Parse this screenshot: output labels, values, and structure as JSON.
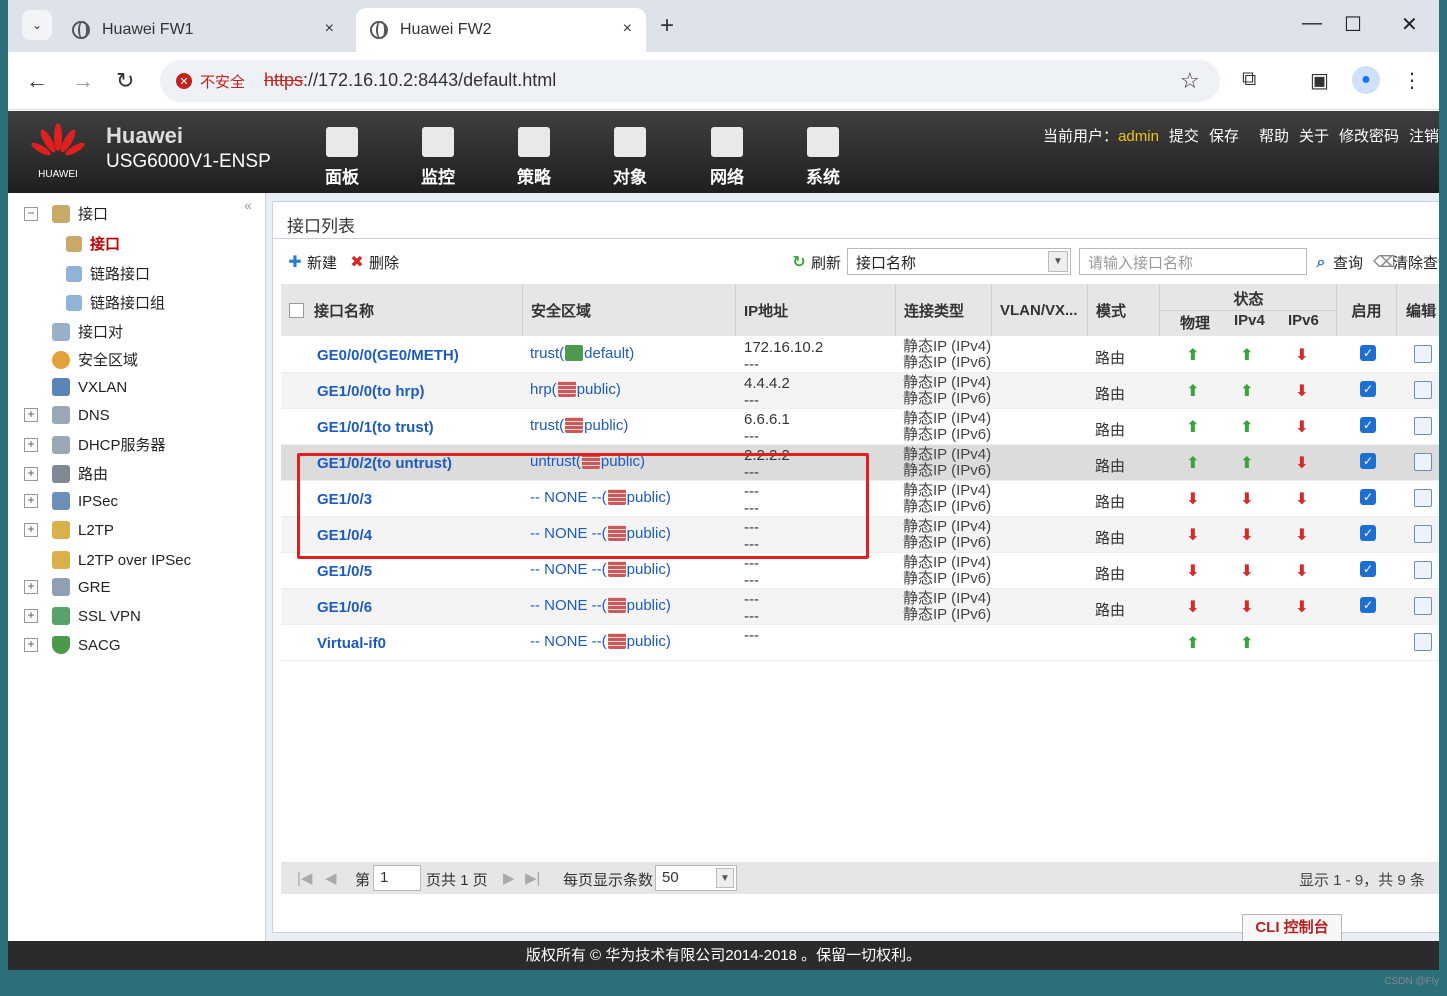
{
  "browser": {
    "tabs": [
      {
        "title": "Huawei FW1",
        "close": "×"
      },
      {
        "title": "Huawei FW2",
        "close": "×"
      }
    ],
    "new_tab": "+",
    "insecure_label": "不安全",
    "url_scheme": "https",
    "url_rest": "://172.16.10.2:8443/default.html"
  },
  "app": {
    "brand_name": "Huawei",
    "brand_model": "USG6000V1-ENSP",
    "logo_text": "HUAWEI",
    "menus": [
      {
        "label": "面板",
        "icon": "dashboard-icon"
      },
      {
        "label": "监控",
        "icon": "monitor-icon"
      },
      {
        "label": "策略",
        "icon": "policy-icon"
      },
      {
        "label": "对象",
        "icon": "object-icon"
      },
      {
        "label": "网络",
        "icon": "network-icon"
      },
      {
        "label": "系统",
        "icon": "system-icon"
      }
    ],
    "active_menu": "网络",
    "userbar": {
      "current_user_label": "当前用户：",
      "username": "admin",
      "links": [
        "提交",
        "保存",
        "帮助",
        "关于",
        "修改密码",
        "注销"
      ]
    }
  },
  "nav": {
    "items": [
      {
        "label": "接口",
        "expander": "−"
      },
      {
        "label": "接口"
      },
      {
        "label": "链路接口"
      },
      {
        "label": "链路接口组"
      },
      {
        "label": "接口对"
      },
      {
        "label": "安全区域"
      },
      {
        "label": "VXLAN"
      },
      {
        "label": "DNS",
        "expander": "+"
      },
      {
        "label": "DHCP服务器",
        "expander": "+"
      },
      {
        "label": "路由",
        "expander": "+"
      },
      {
        "label": "IPSec",
        "expander": "+"
      },
      {
        "label": "L2TP",
        "expander": "+"
      },
      {
        "label": "L2TP over IPSec"
      },
      {
        "label": "GRE",
        "expander": "+"
      },
      {
        "label": "SSL VPN",
        "expander": "+"
      },
      {
        "label": "SACG",
        "expander": "+"
      }
    ],
    "collapse": "«"
  },
  "panel": {
    "title": "接口列表",
    "toolbar": {
      "new": "新建",
      "delete": "删除",
      "refresh": "刷新",
      "filter_select": "接口名称",
      "search_placeholder": "请输入接口名称",
      "query": "查询",
      "clear": "清除查询"
    },
    "headers": {
      "name": "接口名称",
      "zone": "安全区域",
      "ip": "IP地址",
      "conn": "连接类型",
      "vlan": "VLAN/VX...",
      "mode": "模式",
      "status": "状态",
      "phys": "物理",
      "ipv4": "IPv4",
      "ipv6": "IPv6",
      "enable": "启用",
      "edit": "编辑"
    },
    "rows": [
      {
        "name": "GE0/0/0(GE0/METH)",
        "zone_a": "trust(",
        "zone_b": "default)",
        "ip1": "172.16.10.2",
        "ip2": "---",
        "conn1": "静态IP (IPv4)",
        "conn2": "静态IP (IPv6)",
        "mode": "路由",
        "phys": "up",
        "ipv4": "up",
        "ipv6": "down",
        "enabled": true
      },
      {
        "name": "GE1/0/0(to hrp)",
        "zone_a": "hrp(",
        "zone_b": "public)",
        "ip1": "4.4.4.2",
        "ip2": "---",
        "conn1": "静态IP (IPv4)",
        "conn2": "静态IP (IPv6)",
        "mode": "路由",
        "phys": "up",
        "ipv4": "up",
        "ipv6": "down",
        "enabled": true
      },
      {
        "name": "GE1/0/1(to trust)",
        "zone_a": "trust(",
        "zone_b": "public)",
        "ip1": "6.6.6.1",
        "ip2": "---",
        "conn1": "静态IP (IPv4)",
        "conn2": "静态IP (IPv6)",
        "mode": "路由",
        "phys": "up",
        "ipv4": "up",
        "ipv6": "down",
        "enabled": true
      },
      {
        "name": "GE1/0/2(to untrust)",
        "zone_a": "untrust(",
        "zone_b": "public)",
        "ip1": "2.2.2.2",
        "ip2": "---",
        "conn1": "静态IP (IPv4)",
        "conn2": "静态IP (IPv6)",
        "mode": "路由",
        "phys": "up",
        "ipv4": "up",
        "ipv6": "down",
        "enabled": true
      },
      {
        "name": "GE1/0/3",
        "zone_a": "-- NONE --(",
        "zone_b": "public)",
        "ip1": "---",
        "ip2": "---",
        "conn1": "静态IP (IPv4)",
        "conn2": "静态IP (IPv6)",
        "mode": "路由",
        "phys": "down",
        "ipv4": "down",
        "ipv6": "down",
        "enabled": true
      },
      {
        "name": "GE1/0/4",
        "zone_a": "-- NONE --(",
        "zone_b": "public)",
        "ip1": "---",
        "ip2": "---",
        "conn1": "静态IP (IPv4)",
        "conn2": "静态IP (IPv6)",
        "mode": "路由",
        "phys": "down",
        "ipv4": "down",
        "ipv6": "down",
        "enabled": true
      },
      {
        "name": "GE1/0/5",
        "zone_a": "-- NONE --(",
        "zone_b": "public)",
        "ip1": "---",
        "ip2": "---",
        "conn1": "静态IP (IPv4)",
        "conn2": "静态IP (IPv6)",
        "mode": "路由",
        "phys": "down",
        "ipv4": "down",
        "ipv6": "down",
        "enabled": true
      },
      {
        "name": "GE1/0/6",
        "zone_a": "-- NONE --(",
        "zone_b": "public)",
        "ip1": "---",
        "ip2": "---",
        "conn1": "静态IP (IPv4)",
        "conn2": "静态IP (IPv6)",
        "mode": "路由",
        "phys": "down",
        "ipv4": "down",
        "ipv6": "down",
        "enabled": true
      },
      {
        "name": "Virtual-if0",
        "zone_a": "-- NONE --(",
        "zone_b": "public)",
        "ip1": "---",
        "ip2": "",
        "conn1": "",
        "conn2": "",
        "mode": "",
        "phys": "up",
        "ipv4": "up",
        "ipv6": "",
        "enabled": false
      }
    ],
    "pager": {
      "page_prefix": "第",
      "page_value": "1",
      "page_suffix": "页共 1 页",
      "per_page_label": "每页显示条数",
      "per_page_value": "50",
      "summary": "显示 1 - 9，共 9 条"
    },
    "cli_button": "CLI 控制台"
  },
  "footer": "版权所有 © 华为技术有限公司2014-2018 。保留一切权利。",
  "watermark": "CSDN @Fly",
  "colors": {
    "accent_red": "#c00000",
    "link_blue": "#1d5bbf",
    "up_green": "#3aa33a",
    "down_red": "#d62a2a",
    "highlight_box": "#e02020"
  }
}
